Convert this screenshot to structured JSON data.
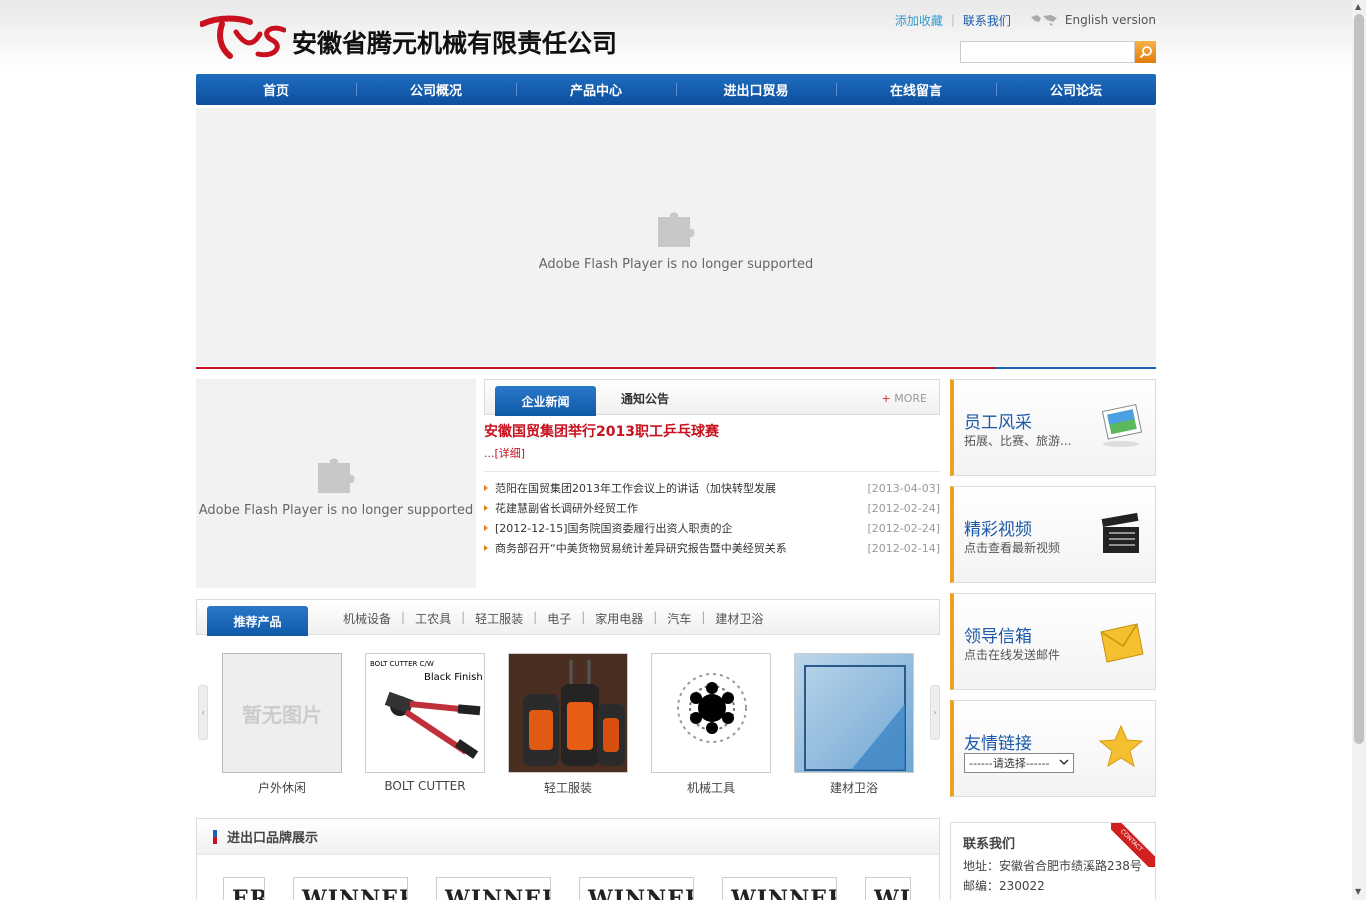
{
  "header": {
    "company_name": "安徽省腾元机械有限责任公司",
    "logo_initials": "TYS",
    "links": {
      "favorite": "添加收藏",
      "separator": "|",
      "contact": "联系我们",
      "english": "English version"
    },
    "search": {
      "placeholder": ""
    }
  },
  "nav": {
    "items": [
      "首页",
      "公司概况",
      "产品中心",
      "进出口贸易",
      "在线留言",
      "公司论坛"
    ]
  },
  "banner": {
    "flash_message": "Adobe Flash Player is no longer supported"
  },
  "left_flash": {
    "flash_message": "Adobe Flash Player is no longer supported"
  },
  "news": {
    "tab_active": "企业新闻",
    "tab_other": "通知公告",
    "more_plus": "+",
    "more_label": "MORE",
    "headline": "安徽国贸集团举行2013职工乒乓球赛",
    "detail_link": "...[详细]",
    "items": [
      {
        "title": "范阳在国贸集团2013年工作会议上的讲话（加快转型发展",
        "date": "[2013-04-03]"
      },
      {
        "title": "花建慧副省长调研外经贸工作",
        "date": "[2012-02-24]"
      },
      {
        "title": "[2012-12-15]国务院国资委履行出资人职责的企",
        "date": "[2012-02-24]"
      },
      {
        "title": "商务部召开“中美货物贸易统计差异研究报告暨中美经贸关系",
        "date": "[2012-02-14]"
      }
    ]
  },
  "products": {
    "tab_label": "推荐产品",
    "categories": [
      "机械设备",
      "工农具",
      "轻工服装",
      "电子",
      "家用电器",
      "汽车",
      "建材卫浴"
    ],
    "cat_separator": "|",
    "left_arrow": "‹",
    "right_arrow": "›",
    "items": [
      {
        "name": "户外休闲",
        "placeholder_text": "暂无图片"
      },
      {
        "name": "BOLT CUTTER",
        "img_text_1": "BOLT CUTTER C/W",
        "img_text_2": "Black Finish"
      },
      {
        "name": "轻工服装"
      },
      {
        "name": "机械工具"
      },
      {
        "name": "建材卫浴"
      }
    ]
  },
  "brands": {
    "title": "进出口品牌展示",
    "logos": [
      "ER",
      "WINNER",
      "WINNER",
      "WINNER",
      "WINNER",
      "WIN"
    ]
  },
  "side": {
    "staff": {
      "title": "员工风采",
      "subtitle": "拓展、比赛、旅游..."
    },
    "video": {
      "title": "精彩视频",
      "subtitle": "点击查看最新视频"
    },
    "mail": {
      "title": "领导信箱",
      "subtitle": "点击在线发送邮件"
    },
    "links": {
      "title": "友情链接",
      "select_value": "------请选择------"
    }
  },
  "contact": {
    "title": "联系我们",
    "ribbon": "CONTACT",
    "address": "地址：安徽省合肥市绩溪路238号",
    "zip": "邮编：230022"
  },
  "colors": {
    "nav_blue": "#1464b4",
    "accent_red": "#c8101e",
    "side_accent": "#f0a020"
  }
}
